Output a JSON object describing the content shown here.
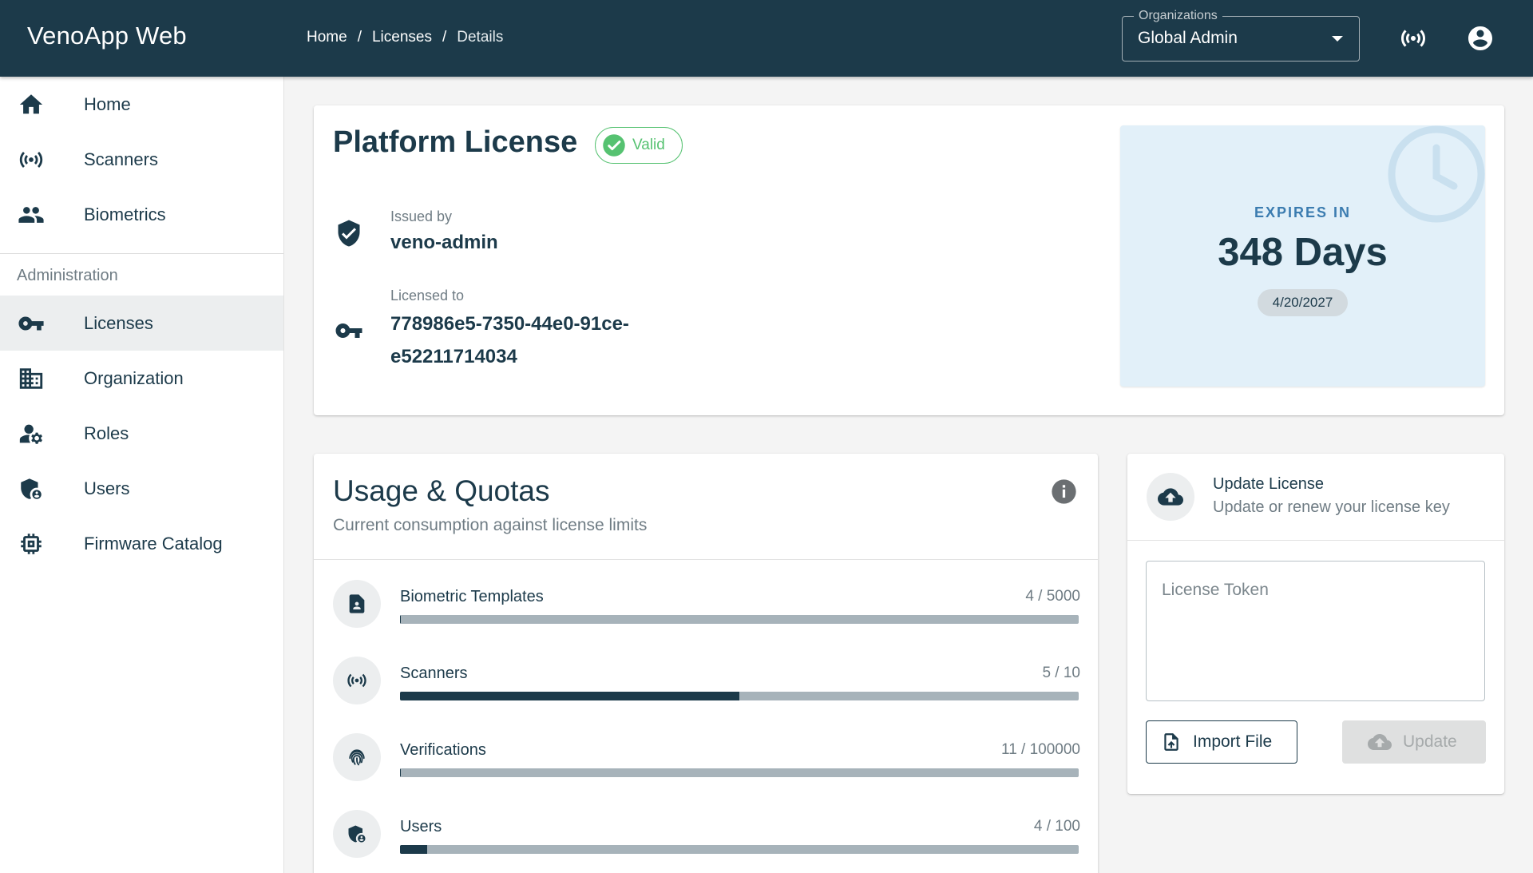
{
  "app": {
    "title": "VenoApp Web"
  },
  "breadcrumb": {
    "home": "Home",
    "licenses": "Licenses",
    "details": "Details",
    "separator": "/"
  },
  "org_select": {
    "legend": "Organizations",
    "value": "Global Admin"
  },
  "header_icons": [
    "scanner-signal-icon",
    "account-circle-icon"
  ],
  "sidebar": {
    "items": [
      {
        "label": "Home",
        "icon": "home-icon"
      },
      {
        "label": "Scanners",
        "icon": "scanner-signal-icon"
      },
      {
        "label": "Biometrics",
        "icon": "people-icon"
      }
    ],
    "section_label": "Administration",
    "admin_items": [
      {
        "label": "Licenses",
        "icon": "key-icon",
        "active": true
      },
      {
        "label": "Organization",
        "icon": "building-icon"
      },
      {
        "label": "Roles",
        "icon": "user-gear-icon"
      },
      {
        "label": "Users",
        "icon": "shield-user-icon"
      },
      {
        "label": "Firmware Catalog",
        "icon": "chip-icon"
      }
    ]
  },
  "license": {
    "title": "Platform License",
    "status": "Valid",
    "issued_by_label": "Issued by",
    "issued_by": "veno-admin",
    "licensed_to_label": "Licensed to",
    "licensed_to_line1": "778986e5-7350-44e0-91ce-",
    "licensed_to_line2": "e52211714034",
    "expires_label": "EXPIRES IN",
    "expires_days": "348 Days",
    "expires_date": "4/20/2027"
  },
  "usage": {
    "title": "Usage & Quotas",
    "subtitle": "Current consumption against license limits",
    "quotas": [
      {
        "name": "Biometric Templates",
        "count": "4 / 5000",
        "used": 4,
        "limit": 5000,
        "icon": "contact-file-icon"
      },
      {
        "name": "Scanners",
        "count": "5 / 10",
        "used": 5,
        "limit": 10,
        "icon": "scanner-signal-icon"
      },
      {
        "name": "Verifications",
        "count": "11 / 100000",
        "used": 11,
        "limit": 100000,
        "icon": "fingerprint-icon"
      },
      {
        "name": "Users",
        "count": "4 / 100",
        "used": 4,
        "limit": 100,
        "icon": "shield-user-icon"
      }
    ]
  },
  "update": {
    "title": "Update License",
    "subtitle": "Update or renew your license key",
    "token_placeholder": "License Token",
    "import_label": "Import File",
    "update_label": "Update"
  },
  "colors": {
    "primary": "#1c3a4a",
    "valid": "#56c271",
    "expiry_bg": "#e2f0f9",
    "expiry_accent": "#3b7cb0",
    "track": "#a7b3ba"
  }
}
